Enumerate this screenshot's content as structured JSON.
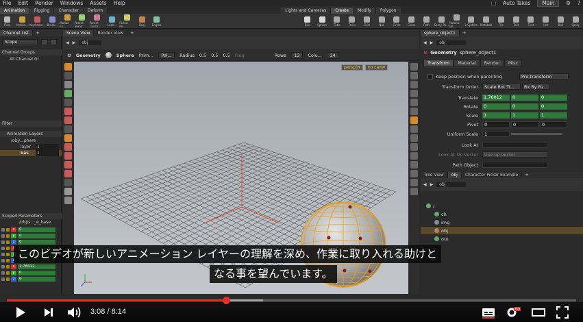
{
  "menubar": {
    "items": [
      "File",
      "Edit",
      "Render",
      "Windows",
      "Assets",
      "Help"
    ],
    "auto_takes": "Auto Takes",
    "desktop": "Main"
  },
  "shelf_tabs_left": [
    "Animation",
    "Rigging",
    "Character",
    "Deform"
  ],
  "shelf_tabs_right": [
    "Lights and Cameras",
    "Create",
    "Modify",
    "Polygon"
  ],
  "shelf_tools_left": [
    "Pose",
    "Motion...",
    "Keyframe...",
    "Break...",
    "Motion Fx...",
    "Parent Blend",
    "Parent Constr...",
    "Lock...",
    "Follow Pa...",
    "Bag",
    "Engine"
  ],
  "shelf_tools_right": [
    "Box",
    "Sphere",
    "Tube",
    "Torus",
    "Grid",
    "Null",
    "Circle",
    "Curve",
    "Path",
    "Spray Pa...",
    "Platonic Sol...",
    "L-System",
    "Metaball",
    "File",
    "Text",
    "Font",
    "Hat",
    "Ball",
    "Spray"
  ],
  "left_panel": {
    "tabs": [
      "Channel List",
      "+"
    ],
    "scope": "Scope",
    "channel_groups": "Channel Groups",
    "all_channel_groups": "All Channel Gr",
    "filter": "Filter",
    "animation_layers": "Animation Layers",
    "layers": [
      {
        "name": "/obj/...phere",
        "value": ""
      },
      {
        "name": "layer",
        "value": "1"
      },
      {
        "name": "bas",
        "value": "1"
      }
    ],
    "scoped_parameters": "Scoped Parameters",
    "scoped_path": "/obj/s..._e_base",
    "params": [
      {
        "axis": "x",
        "value": "0"
      },
      {
        "axis": "y",
        "value": "0"
      },
      {
        "axis": "z",
        "value": "0"
      },
      {
        "axis": "x",
        "value": "0"
      },
      {
        "axis": "y",
        "value": "0"
      },
      {
        "axis": "z",
        "value": "0"
      },
      {
        "axis": "x",
        "value": "1.76012"
      },
      {
        "axis": "y",
        "value": "0"
      },
      {
        "axis": "z",
        "value": "0"
      }
    ]
  },
  "scene": {
    "tabs": [
      "Scene View",
      "Render View",
      "+"
    ],
    "path": "obj",
    "geometry_label": "Geometry",
    "sphere_label": "Sphere",
    "prim_label": "Prim...",
    "poly_menu": "Pol...",
    "radius_label": "Radius",
    "radius": [
      "0.5",
      "0.5",
      "0.5"
    ],
    "freq_label": "Freq",
    "rows_label": "Rows",
    "rows": "13",
    "cols_label": "Colu...",
    "cols": "24",
    "persp": "persp1▾",
    "nocam": "no cam▾"
  },
  "right_panel": {
    "tabs": [
      "sphere_object1",
      "+"
    ],
    "path": "obj",
    "header_type": "Geometry",
    "header_name": "sphere_object1",
    "param_tabs": [
      "Transform",
      "Material",
      "Render",
      "Misc"
    ],
    "keep_position": "Keep position when parenting",
    "keep_position_value": "Pre-transform",
    "transform_order_label": "Transform Order",
    "transform_order": "Scale Rot Tr...",
    "rot_order": "Rx Ry Rz",
    "rows": [
      {
        "label": "Translate",
        "values": [
          "1.76012",
          "0",
          "0"
        ]
      },
      {
        "label": "Rotate",
        "values": [
          "0",
          "0",
          "0"
        ]
      },
      {
        "label": "Scale",
        "values": [
          "1",
          "1",
          "1"
        ]
      },
      {
        "label": "Pivot",
        "values": [
          "0",
          "0",
          "0"
        ]
      }
    ],
    "uniform_scale_label": "Uniform Scale",
    "uniform_scale": "1",
    "look_at_label": "Look At",
    "look_at_up_label": "Look At Up Vector",
    "look_at_up": "Use up vector",
    "path_object_label": "Path Object"
  },
  "tree_panel": {
    "tabs": [
      "Tree View",
      "obj",
      "Character Picker Example",
      "+"
    ],
    "path": "obj",
    "nodes": [
      "/",
      "ch",
      "img",
      "obj",
      "out"
    ]
  },
  "subtitle": {
    "line1": "このビデオが新しいアニメーション レイヤーの理解を深め、作業に取り入れる助けと",
    "line2": "なる事を望んでいます。"
  },
  "player": {
    "current": "3:08",
    "total": "8:14",
    "progress": 0.385,
    "buffered": 0.45
  },
  "colors": {
    "accent_red": "#e52d27",
    "param_green": "#2f7a3a",
    "selection": "#5a4728"
  }
}
